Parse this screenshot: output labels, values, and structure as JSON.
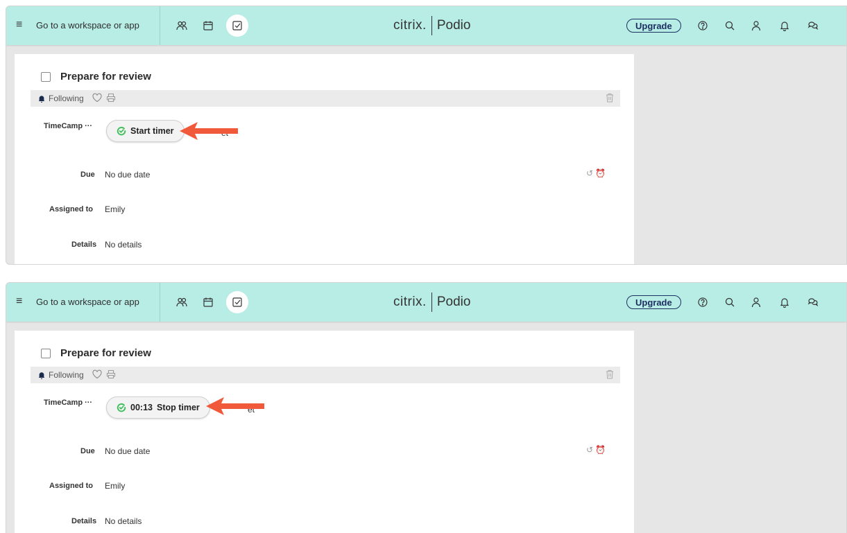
{
  "panels": [
    {
      "topbar": {
        "goto": "Go to a workspace or app",
        "brand_citrix": "citrix.",
        "brand_podio": "Podio",
        "upgrade": "Upgrade"
      },
      "task": {
        "title": "Prepare for review",
        "following": "Following",
        "timecamp_label": "TimeCamp ···",
        "timer_label": "Start timer",
        "behind_text": "et",
        "due_label": "Due",
        "due_value": "No due date",
        "assigned_label": "Assigned to",
        "assigned_value": "Emily",
        "details_label": "Details",
        "details_value": "No details"
      }
    },
    {
      "topbar": {
        "goto": "Go to a workspace or app",
        "brand_citrix": "citrix.",
        "brand_podio": "Podio",
        "upgrade": "Upgrade"
      },
      "task": {
        "title": "Prepare for review",
        "following": "Following",
        "timecamp_label": "TimeCamp ···",
        "timer_time": "00:13",
        "timer_label": "Stop timer",
        "behind_text": "et",
        "due_label": "Due",
        "due_value": "No due date",
        "assigned_label": "Assigned to",
        "assigned_value": "Emily",
        "details_label": "Details",
        "details_value": "No details"
      }
    }
  ],
  "icons": {
    "menu": "hamburger-icon",
    "nav": [
      "contacts-icon",
      "calendar-icon",
      "tasks-icon"
    ],
    "right": [
      "help-icon",
      "search-icon",
      "profile-icon",
      "notifications-icon",
      "chat-icon"
    ],
    "timer": "timecamp-logo-icon",
    "annotation": "red-arrow-icon"
  },
  "colors": {
    "topbar_bg": "#b8ede6",
    "upgrade_border": "#1c3060",
    "timer_accent": "#3fbf5c",
    "arrow": "#f05a3a"
  }
}
